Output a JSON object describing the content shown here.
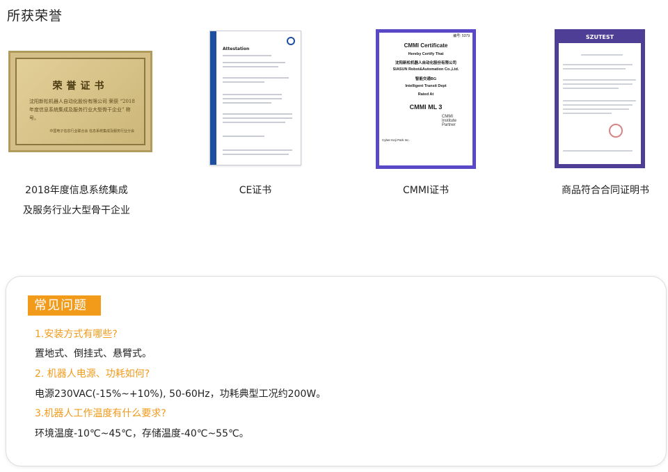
{
  "section_title": "所获荣誉",
  "certificates": [
    {
      "caption_line1": "2018年度信息系统集成",
      "caption_line2": "及服务行业大型骨干企业",
      "plaque_title": "荣誉证书",
      "plaque_body": "沈阳新松机器人自动化股份有限公司 荣获 “2018 年度信息系统集成及服务行业大型骨干企业” 称号。",
      "plaque_footer": "中国电子信息行业联合会 信息系统集成及服务行业分会"
    },
    {
      "caption": "CE证书",
      "doc_title": "Attestation"
    },
    {
      "caption": "CMMI证书",
      "doc_number": "编号: 5379",
      "doc_title": "CMMI Certificate",
      "line1": "Hereby Certify That",
      "line2": "沈阳新松机器人自动化股份有限公司",
      "line3": "SIASUN Robot&Automation Co.,Ltd.",
      "line4": "智能交通BG",
      "line5": "Intelligent Transit Dept",
      "line6": "Rated At",
      "level": "CMMI ML 3",
      "partner": "CMMI Institute Partner",
      "footer": "Cyber Keji Park Inc."
    },
    {
      "caption": "商品符合合同证明书",
      "brand": "SZUTEST"
    }
  ],
  "faq": {
    "title": "常见问题",
    "items": [
      {
        "question": "1.安装方式有哪些?",
        "answer": "置地式、倒挂式、悬臂式。"
      },
      {
        "question": "2. 机器人电源、功耗如何?",
        "answer": "电源230VAC(-15%~+10%), 50-60Hz，功耗典型工况约200W。"
      },
      {
        "question": "3.机器人工作温度有什么要求?",
        "answer": "环境温度-10℃~45℃，存储温度-40℃~55℃。"
      }
    ]
  }
}
